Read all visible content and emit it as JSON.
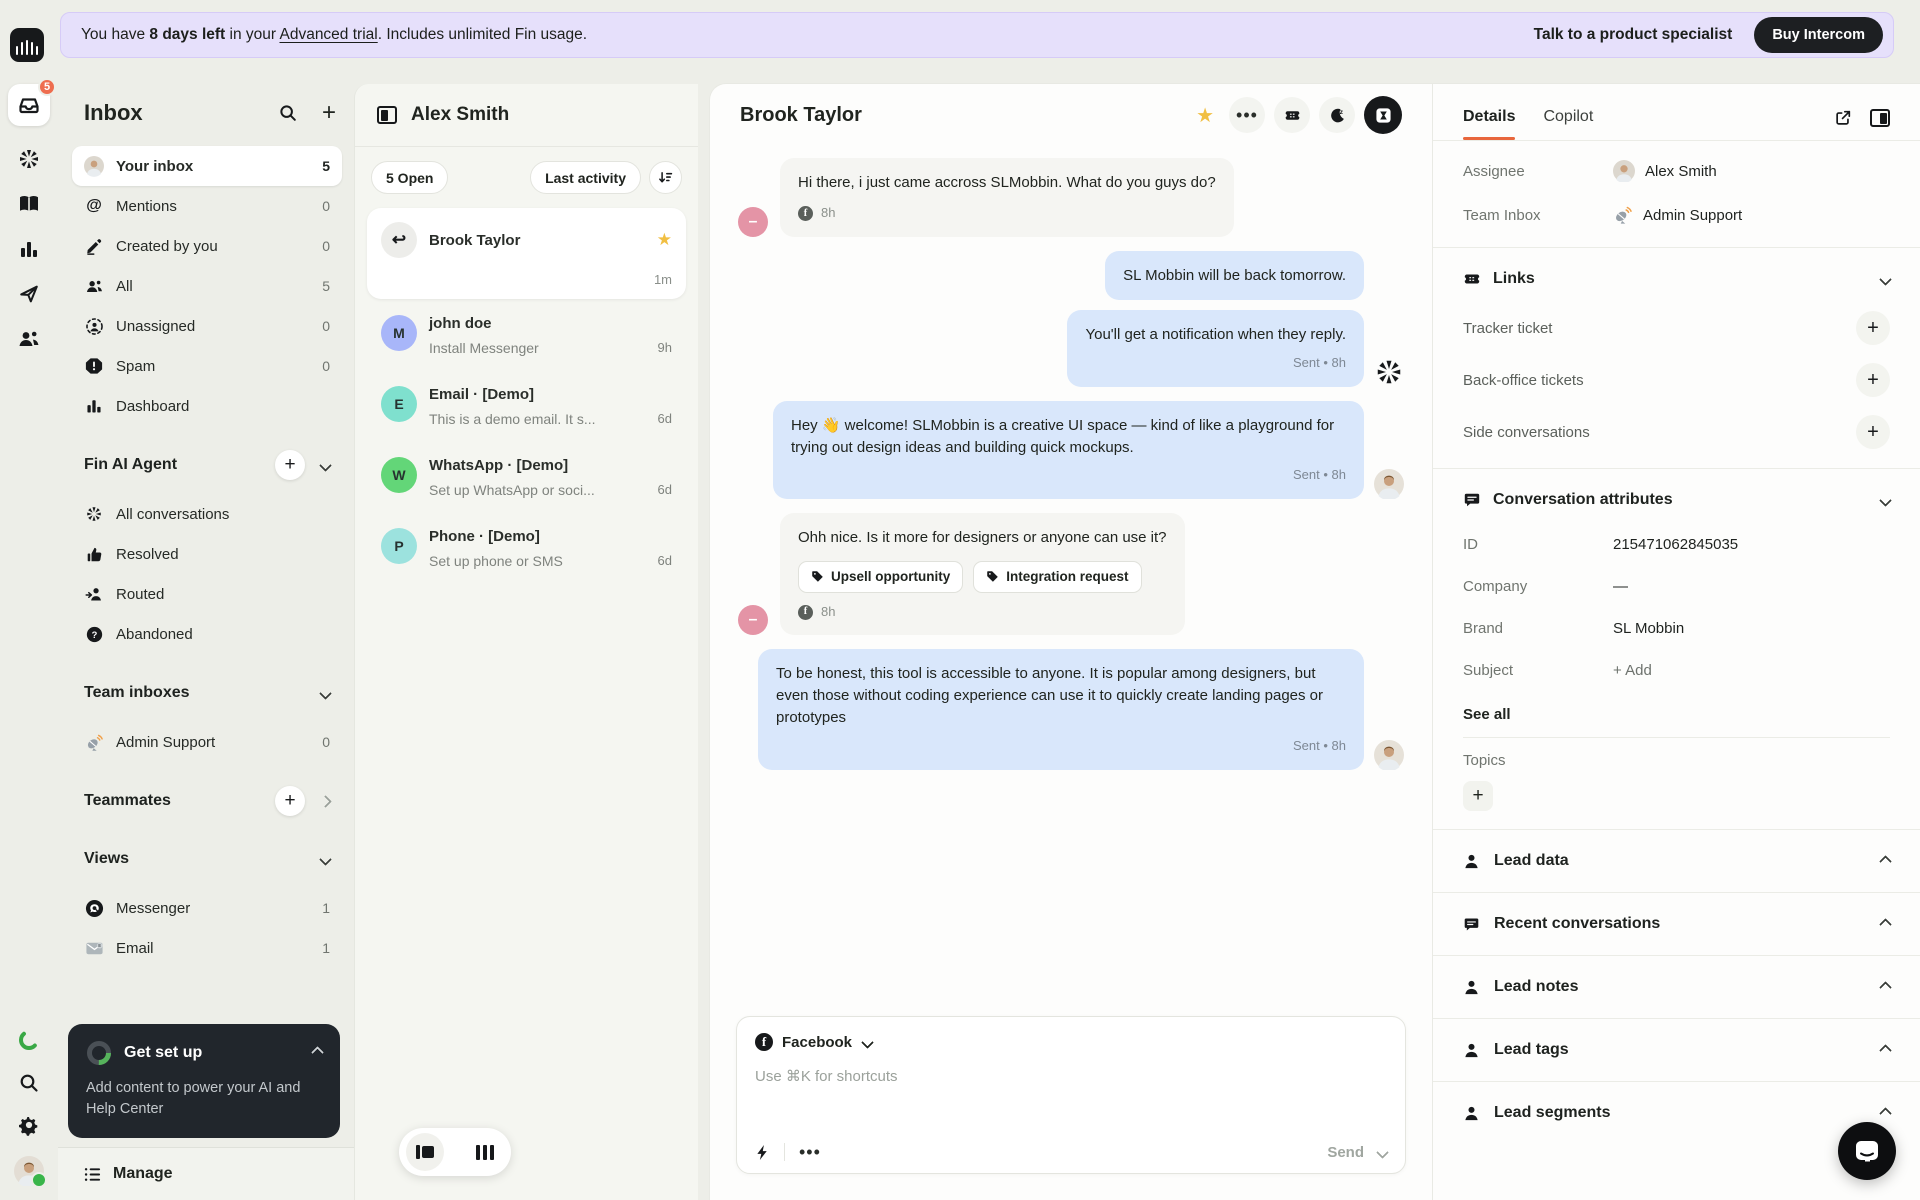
{
  "banner": {
    "prefix": "You have ",
    "days_left": "8 days left",
    "mid": " in your ",
    "trial_link": "Advanced trial",
    "suffix": ". Includes unlimited Fin usage.",
    "specialist_link": "Talk to a product specialist",
    "buy_button": "Buy Intercom"
  },
  "rail": {
    "inbox_badge": "5",
    "icons": [
      "inbox-icon",
      "fin-ai-icon",
      "knowledge-icon",
      "reports-icon",
      "outbound-icon",
      "contacts-icon",
      "trial-progress-icon",
      "search-icon",
      "settings-icon",
      "avatar"
    ]
  },
  "sidebar": {
    "title": "Inbox",
    "items": [
      {
        "label": "Your inbox",
        "count": "5"
      },
      {
        "label": "Mentions",
        "count": "0"
      },
      {
        "label": "Created by you",
        "count": "0"
      },
      {
        "label": "All",
        "count": "5"
      },
      {
        "label": "Unassigned",
        "count": "0"
      },
      {
        "label": "Spam",
        "count": "0"
      },
      {
        "label": "Dashboard",
        "count": ""
      }
    ],
    "fin_section": {
      "title": "Fin AI Agent",
      "items": [
        {
          "label": "All conversations"
        },
        {
          "label": "Resolved"
        },
        {
          "label": "Routed"
        },
        {
          "label": "Abandoned"
        }
      ]
    },
    "team_inboxes": {
      "title": "Team inboxes",
      "items": [
        {
          "label": "Admin Support",
          "count": "0"
        }
      ]
    },
    "teammates_title": "Teammates",
    "views": {
      "title": "Views",
      "items": [
        {
          "label": "Messenger",
          "count": "1"
        },
        {
          "label": "Email",
          "count": "1"
        }
      ]
    },
    "get_set_up": {
      "title": "Get set up",
      "body": "Add content to power your AI and Help Center"
    },
    "manage_label": "Manage"
  },
  "conversation_list": {
    "header": "Alex Smith",
    "open_filter": "5 Open",
    "sort_filter": "Last activity",
    "selected": {
      "name": "Brook Taylor",
      "time": "1m",
      "star": "★",
      "avatar_glyph": "↩"
    },
    "items": [
      {
        "name": "john doe",
        "preview": "Install Messenger",
        "time": "9h",
        "letter": "M",
        "color": "#a8b6f9"
      },
      {
        "name": "Email · [Demo]",
        "preview": "This is a demo email. It s...",
        "time": "6d",
        "letter": "E",
        "color": "#7fe0ce"
      },
      {
        "name": "WhatsApp · [Demo]",
        "preview": "Set up WhatsApp or soci...",
        "time": "6d",
        "letter": "W",
        "color": "#63d678"
      },
      {
        "name": "Phone · [Demo]",
        "preview": "Set up phone or SMS",
        "time": "6d",
        "letter": "P",
        "color": "#9ce2de"
      }
    ]
  },
  "chat": {
    "header": "Brook Taylor",
    "messages": [
      {
        "text": "Hi there, i just came accross SLMobbin. What do you guys do?",
        "meta_time": "8h"
      },
      {
        "text": "SL Mobbin will be back tomorrow."
      },
      {
        "text": "You'll get a notification when they reply.",
        "meta": "Sent • 8h"
      },
      {
        "text": "Hey 👋 welcome! SLMobbin is a creative UI space — kind of like a playground for trying out design ideas and building quick mockups.",
        "meta": "Sent • 8h"
      },
      {
        "text": "Ohh nice. Is it more for designers or anyone can use it?",
        "meta_time": "8h",
        "tags": [
          "Upsell opportunity",
          "Integration request"
        ]
      },
      {
        "text": "To be honest, this tool is accessible to anyone. It is popular among designers, but even those without coding experience can use it to quickly create landing pages or prototypes",
        "meta": "Sent • 8h"
      }
    ],
    "composer": {
      "channel": "Facebook",
      "placeholder": "Use ⌘K for shortcuts",
      "send_label": "Send"
    }
  },
  "details": {
    "tabs": [
      {
        "label": "Details"
      },
      {
        "label": "Copilot"
      }
    ],
    "assignee_label": "Assignee",
    "assignee_value": "Alex Smith",
    "team_inbox_label": "Team Inbox",
    "team_inbox_value": "Admin Support",
    "links": {
      "title": "Links",
      "items": [
        {
          "label": "Tracker ticket"
        },
        {
          "label": "Back-office tickets"
        },
        {
          "label": "Side conversations"
        }
      ]
    },
    "attributes": {
      "title": "Conversation attributes",
      "rows": [
        {
          "label": "ID",
          "value": "215471062845035"
        },
        {
          "label": "Company",
          "value": "—"
        },
        {
          "label": "Brand",
          "value": "SL Mobbin"
        },
        {
          "label": "Subject",
          "value": "+ Add"
        }
      ],
      "see_all": "See all",
      "topics_label": "Topics"
    },
    "sections": [
      {
        "label": "Lead data"
      },
      {
        "label": "Recent conversations"
      },
      {
        "label": "Lead notes"
      },
      {
        "label": "Lead tags"
      },
      {
        "label": "Lead segments"
      }
    ]
  },
  "colors": {
    "app_bg": "#edeee8",
    "banner_purple": "#e6e0fb",
    "accent_orange": "#e8663c",
    "badge_red": "#ee6d4f",
    "bubble_blue": "#d9e7fb",
    "bubble_gray": "#f5f5f2",
    "star_yellow": "#f1bf42",
    "customer_avatar_pink": "#e494a6",
    "dark_button": "#1d1f22",
    "online_green": "#39b54a"
  },
  "icon_glyphs": {
    "star": "★",
    "reply": "↩",
    "minus": "–",
    "at": "@",
    "pencil": "✎",
    "plus": "+",
    "dots": "⋯"
  }
}
